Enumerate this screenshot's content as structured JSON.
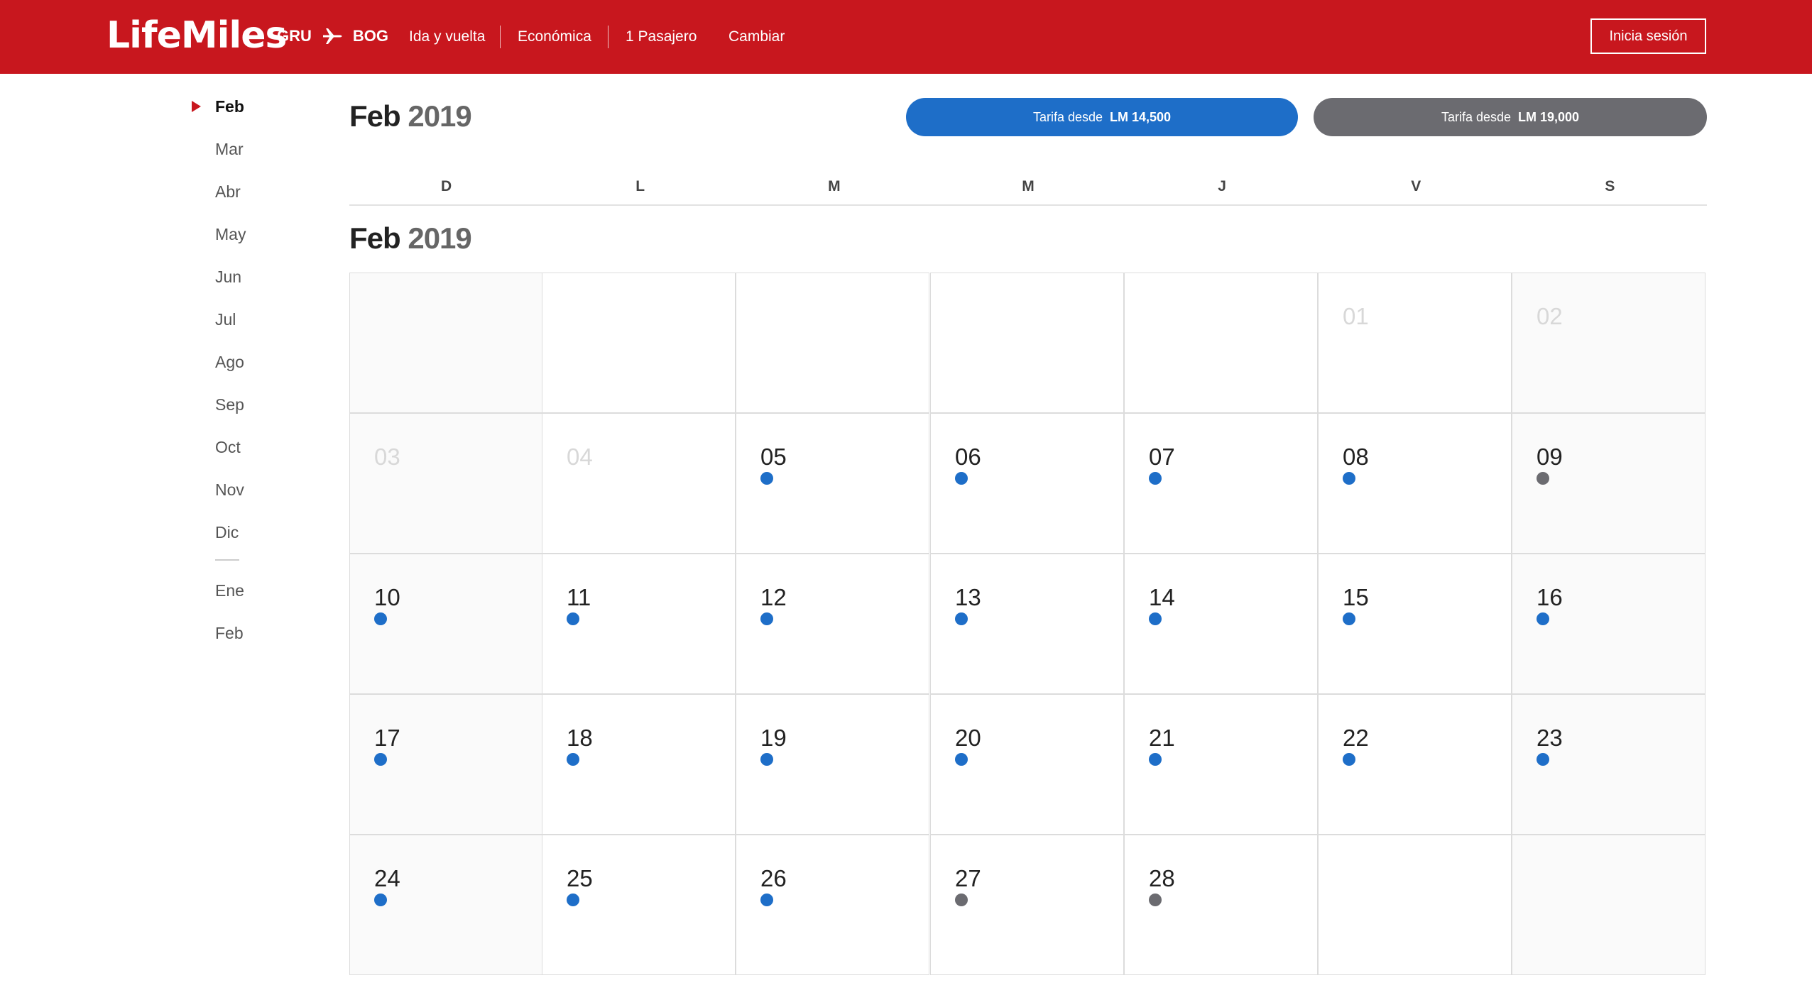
{
  "header": {
    "logo": "LifeMiles",
    "origin": "GRU",
    "destination": "BOG",
    "trip_type": "Ida y vuelta",
    "cabin": "Económica",
    "passengers": "1 Pasajero",
    "change": "Cambiar",
    "login": "Inicia sesión"
  },
  "sidebar": {
    "months_2019": [
      "Feb",
      "Mar",
      "Abr",
      "May",
      "Jun",
      "Jul",
      "Ago",
      "Sep",
      "Oct",
      "Nov",
      "Dic"
    ],
    "months_2020": [
      "Ene",
      "Feb"
    ],
    "active": "Feb"
  },
  "main": {
    "month": "Feb",
    "year": "2019",
    "fare_blue_prefix": "Tarifa desde",
    "fare_blue_value": "LM 14,500",
    "fare_gray_prefix": "Tarifa desde",
    "fare_gray_value": "LM 19,000",
    "weekdays": [
      "D",
      "L",
      "M",
      "M",
      "J",
      "V",
      "S"
    ],
    "section_month": "Feb",
    "section_year": "2019"
  },
  "calendar": {
    "colors": {
      "blue": "#1e6ec8",
      "gray": "#6b6b70",
      "header_red": "#c8171e"
    },
    "weeks": [
      [
        null,
        null,
        null,
        null,
        null,
        {
          "day": "01",
          "disabled": true
        },
        {
          "day": "02",
          "disabled": true
        }
      ],
      [
        {
          "day": "03",
          "disabled": true
        },
        {
          "day": "04",
          "disabled": true
        },
        {
          "day": "05",
          "dot": "blue"
        },
        {
          "day": "06",
          "dot": "blue"
        },
        {
          "day": "07",
          "dot": "blue"
        },
        {
          "day": "08",
          "dot": "blue"
        },
        {
          "day": "09",
          "dot": "gray"
        }
      ],
      [
        {
          "day": "10",
          "dot": "blue"
        },
        {
          "day": "11",
          "dot": "blue"
        },
        {
          "day": "12",
          "dot": "blue"
        },
        {
          "day": "13",
          "dot": "blue"
        },
        {
          "day": "14",
          "dot": "blue"
        },
        {
          "day": "15",
          "dot": "blue"
        },
        {
          "day": "16",
          "dot": "blue"
        }
      ],
      [
        {
          "day": "17",
          "dot": "blue"
        },
        {
          "day": "18",
          "dot": "blue"
        },
        {
          "day": "19",
          "dot": "blue"
        },
        {
          "day": "20",
          "dot": "blue"
        },
        {
          "day": "21",
          "dot": "blue"
        },
        {
          "day": "22",
          "dot": "blue"
        },
        {
          "day": "23",
          "dot": "blue"
        }
      ],
      [
        {
          "day": "24",
          "dot": "blue"
        },
        {
          "day": "25",
          "dot": "blue"
        },
        {
          "day": "26",
          "dot": "blue"
        },
        {
          "day": "27",
          "dot": "gray"
        },
        {
          "day": "28",
          "dot": "gray"
        },
        null,
        null
      ]
    ]
  }
}
